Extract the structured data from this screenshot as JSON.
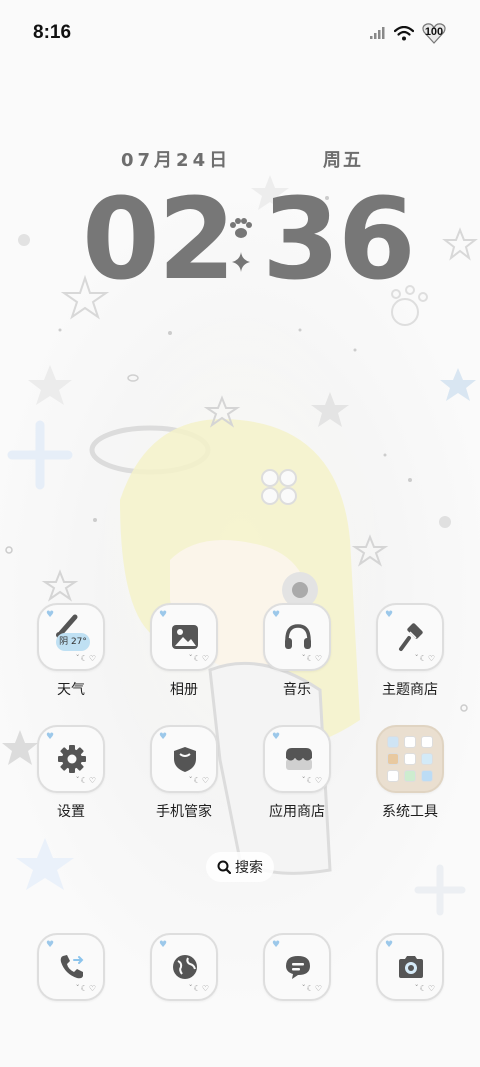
{
  "status_bar": {
    "time": "8:16",
    "battery": "100"
  },
  "clock": {
    "date": "07月24日",
    "weekday": "周五",
    "hours": "02",
    "minutes": "36"
  },
  "apps": [
    {
      "label": "天气",
      "icon": "weather-icon",
      "badge": "阴 27°"
    },
    {
      "label": "相册",
      "icon": "gallery-icon"
    },
    {
      "label": "音乐",
      "icon": "headphones-icon"
    },
    {
      "label": "主题商店",
      "icon": "paintbrush-icon"
    },
    {
      "label": "设置",
      "icon": "gear-icon"
    },
    {
      "label": "手机管家",
      "icon": "shield-icon"
    },
    {
      "label": "应用商店",
      "icon": "store-icon"
    },
    {
      "label": "系统工具",
      "icon": "folder-icon"
    }
  ],
  "search": {
    "label": "搜索"
  },
  "dock": [
    {
      "icon": "phone-icon"
    },
    {
      "icon": "browser-icon"
    },
    {
      "icon": "messages-icon"
    },
    {
      "icon": "camera-icon"
    }
  ],
  "colors": {
    "clock_gray": "#777777",
    "tile_border": "#dedede",
    "heart_blue": "#9cc8ea",
    "weather_blue": "#bfe0f3"
  }
}
